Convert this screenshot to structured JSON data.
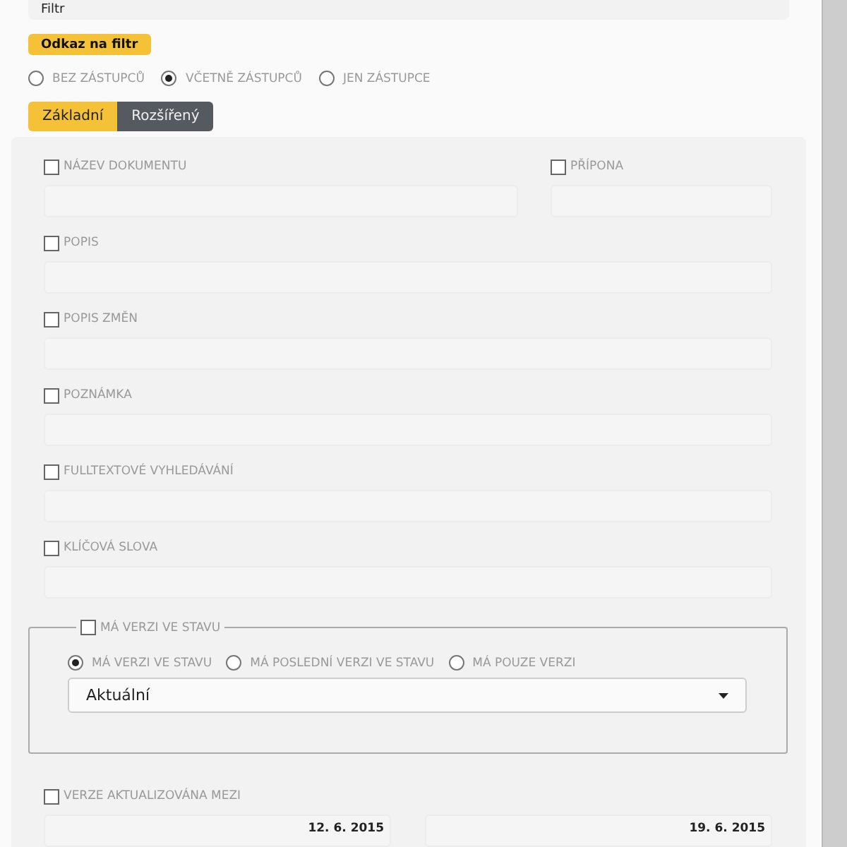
{
  "filter_field": {
    "value": "Filtr"
  },
  "filter_link_button": {
    "label": "Odkaz na filtr"
  },
  "substitute_options": [
    {
      "label": "BEZ ZÁSTUPCŮ",
      "selected": false
    },
    {
      "label": "VČETNĚ ZÁSTUPCŮ",
      "selected": true
    },
    {
      "label": "JEN ZÁSTUPCE",
      "selected": false
    }
  ],
  "tabs": [
    {
      "label": "Základní",
      "selected": true
    },
    {
      "label": "Rozšířený",
      "selected": false
    }
  ],
  "fields_row": [
    {
      "label": "NÁZEV DOKUMENTU",
      "checked": false
    },
    {
      "label": "PŘÍPONA",
      "checked": false
    }
  ],
  "fields": [
    {
      "label": "POPIS",
      "checked": false
    },
    {
      "label": "POPIS ZMĚN",
      "checked": false
    },
    {
      "label": "POZNÁMKA",
      "checked": false
    },
    {
      "label": "FULLTEXTOVÉ VYHLEDÁVÁNÍ",
      "checked": false
    },
    {
      "label": "KLÍČOVÁ SLOVA",
      "checked": false
    }
  ],
  "version_state": {
    "label": "MÁ VERZI VE STAVU",
    "checked": false,
    "options": [
      {
        "label": "MÁ VERZI VE STAVU",
        "selected": true
      },
      {
        "label": "MÁ POSLEDNÍ VERZI VE STAVU",
        "selected": false
      },
      {
        "label": "MÁ POUZE VERZI",
        "selected": false
      }
    ],
    "dropdown": {
      "value": "Aktuální"
    }
  },
  "updated_between": {
    "label": "VERZE AKTUALIZOVÁNA MEZI",
    "checked": false,
    "from": "12. 6. 2015",
    "to": "19. 6. 2015"
  }
}
